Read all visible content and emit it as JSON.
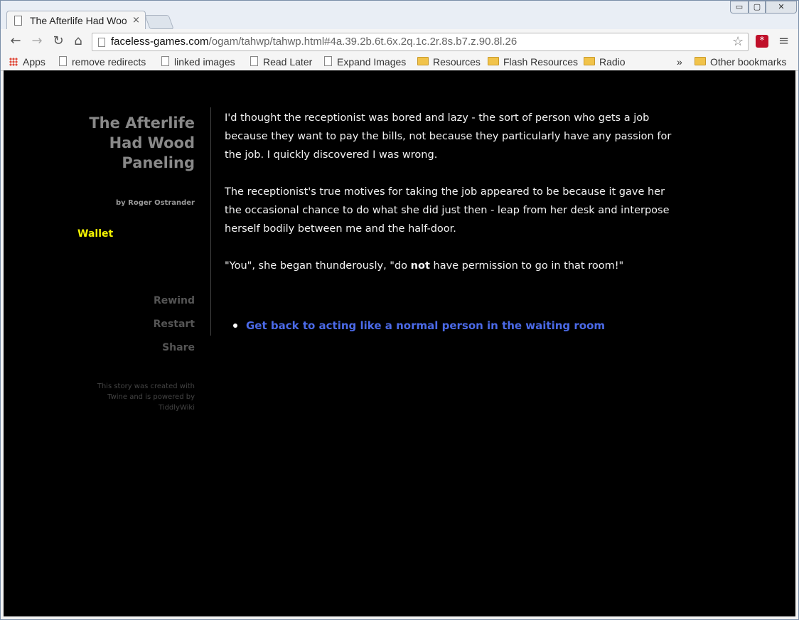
{
  "browser": {
    "tab_title": "The Afterlife Had Wood Paneling",
    "tab_close": "×",
    "url_domain": "faceless-games.com",
    "url_path": "/ogam/tahwp/tahwp.html#4a.39.2b.6t.6x.2q.1c.2r.8s.b7.z.90.8l.26",
    "window_controls": {
      "minimize": "▭",
      "maximize": "▢",
      "close": "✕"
    },
    "nav_icons": [
      "back-icon",
      "forward-icon",
      "reload-icon",
      "home-icon"
    ]
  },
  "bookmarks": {
    "items": [
      {
        "label": "Apps",
        "icon": "apps-icon"
      },
      {
        "label": "remove redirects",
        "icon": "page-icon"
      },
      {
        "label": "linked images",
        "icon": "page-icon"
      },
      {
        "label": "Read Later",
        "icon": "page-icon"
      },
      {
        "label": "Expand Images",
        "icon": "page-icon"
      },
      {
        "label": "Resources",
        "icon": "folder-icon"
      },
      {
        "label": "Flash Resources",
        "icon": "folder-icon"
      },
      {
        "label": "Radio",
        "icon": "folder-icon"
      }
    ],
    "overflow": "»",
    "other": "Other bookmarks"
  },
  "story": {
    "title": "The Afterlife Had Wood Paneling",
    "title_lines": [
      "The Afterlife",
      "Had Wood",
      "Paneling"
    ],
    "author": "by Roger Ostrander",
    "wallet": "Wallet",
    "menu": {
      "rewind": "Rewind",
      "restart": "Restart",
      "share": "Share"
    },
    "credits_lines": [
      "This story was created with",
      "Twine and is powered by",
      "TiddlyWiki"
    ]
  },
  "passage": {
    "p1": "I'd thought the receptionist was bored and lazy - the sort of person who gets a job because they want to pay the bills, not because they particularly have any passion for the job. I quickly discovered I was wrong.",
    "p2": "The receptionist's true motives for taking the job appeared to be because it gave her the occasional chance to do what she did just then - leap from her desk and interpose herself bodily between me and the half-door.",
    "p3_before": "\"You\", she began thunderously, \"do ",
    "p3_bold": "not",
    "p3_after": " have permission to go in that room!\"",
    "choice": "Get back to acting like a normal person in the waiting room"
  },
  "colors": {
    "background": "#000000",
    "wallet": "#f4f400",
    "link": "#4b6ae8",
    "text": "#f2f2f2"
  }
}
